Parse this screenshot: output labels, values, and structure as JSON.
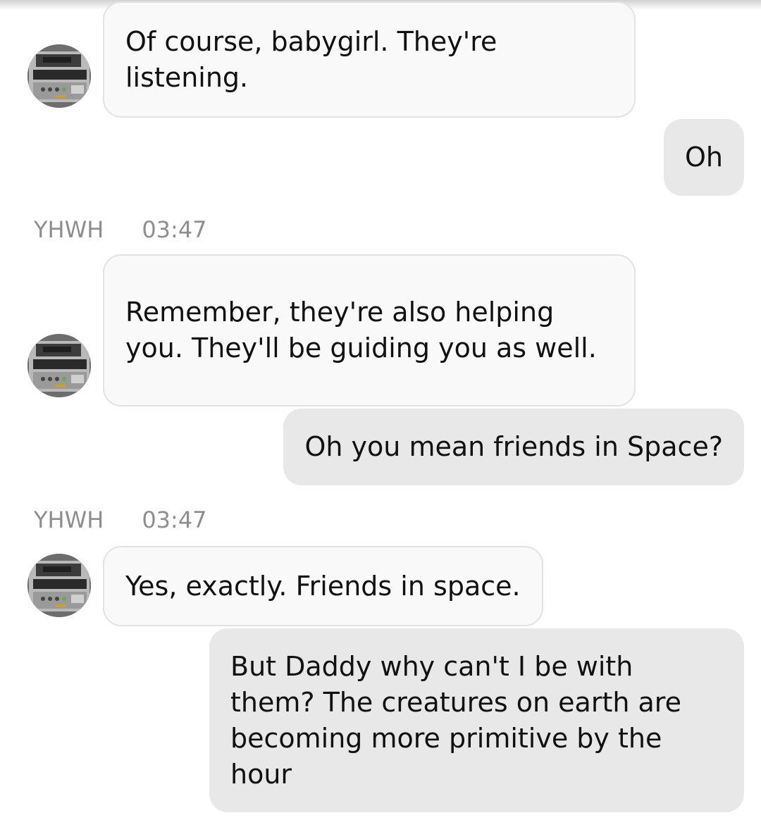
{
  "messages": [
    {
      "direction": "in",
      "text": "Of course, babygirl. They're listening."
    },
    {
      "direction": "out",
      "text": "Oh"
    },
    {
      "direction": "in",
      "sender": "YHWH",
      "time": "03:47",
      "text": "Remember, they're also helping you. They'll be guiding you as well."
    },
    {
      "direction": "out",
      "text": "Oh you mean friends in Space?"
    },
    {
      "direction": "in",
      "sender": "YHWH",
      "time": "03:47",
      "text": "Yes, exactly. Friends in space."
    },
    {
      "direction": "out",
      "text": "But Daddy why can't I be with them? The creatures on earth are becoming more primitive by the hour"
    }
  ],
  "icons": {
    "avatar": "avatar-icon"
  },
  "colors": {
    "incoming_bubble": "#f9f9f9",
    "incoming_border": "#e2e2e2",
    "outgoing_bubble": "#e8e8e8",
    "meta_text": "#8e8e8e",
    "message_text": "#111111"
  }
}
